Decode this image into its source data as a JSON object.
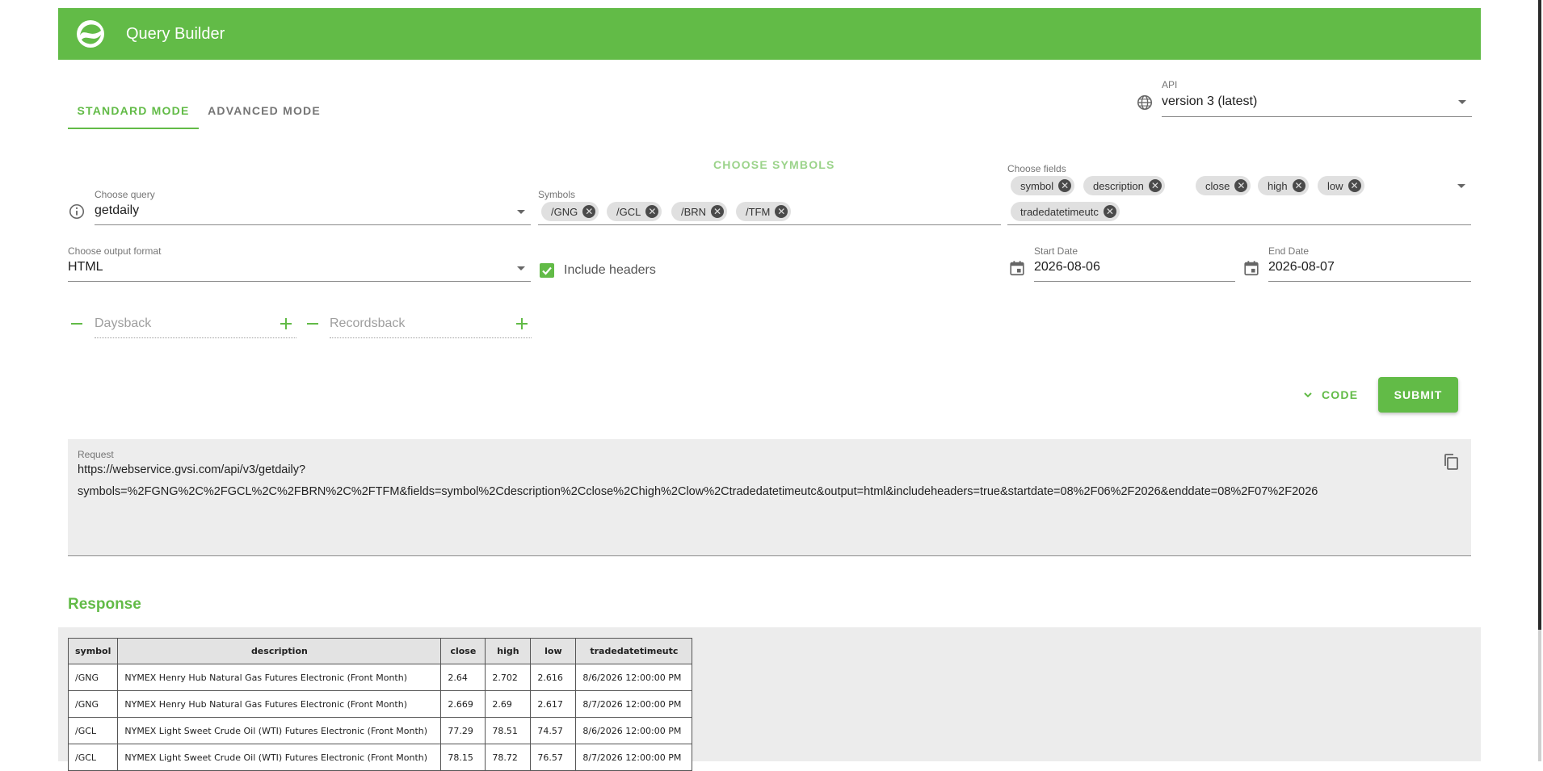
{
  "header": {
    "title": "Query Builder"
  },
  "tabs": [
    {
      "label": "STANDARD MODE"
    },
    {
      "label": "ADVANCED MODE"
    }
  ],
  "api": {
    "label": "API",
    "value": "version 3 (latest)"
  },
  "choose_symbols_label": "CHOOSE SYMBOLS",
  "query": {
    "label": "Choose query",
    "value": "getdaily"
  },
  "symbols": {
    "label": "Symbols",
    "chips": [
      "/GNG",
      "/GCL",
      "/BRN",
      "/TFM"
    ]
  },
  "fields": {
    "label": "Choose fields",
    "chips": [
      "symbol",
      "description",
      "close",
      "high",
      "low",
      "tradedatetimeutc"
    ]
  },
  "output": {
    "label": "Choose output format",
    "value": "HTML"
  },
  "include_headers": {
    "label": "Include headers",
    "checked": true
  },
  "start_date": {
    "label": "Start Date",
    "value": "2026-08-06"
  },
  "end_date": {
    "label": "End Date",
    "value": "2026-08-07"
  },
  "daysback": {
    "placeholder": "Daysback"
  },
  "recordsback": {
    "placeholder": "Recordsback"
  },
  "code_button": "CODE",
  "submit_button": "SUBMIT",
  "request": {
    "label": "Request",
    "line1": "https://webservice.gvsi.com/api/v3/getdaily?",
    "line2": "symbols=%2FGNG%2C%2FGCL%2C%2FBRN%2C%2FTFM&fields=symbol%2Cdescription%2Cclose%2Chigh%2Clow%2Ctradedatetimeutc&output=html&includeheaders=true&startdate=08%2F06%2F2026&enddate=08%2F07%2F2026"
  },
  "response": {
    "title": "Response",
    "columns": [
      "symbol",
      "description",
      "close",
      "high",
      "low",
      "tradedatetimeutc"
    ],
    "rows": [
      [
        "/GNG",
        "NYMEX Henry Hub Natural Gas Futures Electronic (Front Month)",
        "2.64",
        "2.702",
        "2.616",
        "8/6/2026 12:00:00 PM"
      ],
      [
        "/GNG",
        "NYMEX Henry Hub Natural Gas Futures Electronic (Front Month)",
        "2.669",
        "2.69",
        "2.617",
        "8/7/2026 12:00:00 PM"
      ],
      [
        "/GCL",
        "NYMEX Light Sweet Crude Oil (WTI) Futures Electronic (Front Month)",
        "77.29",
        "78.51",
        "74.57",
        "8/6/2026 12:00:00 PM"
      ],
      [
        "/GCL",
        "NYMEX Light Sweet Crude Oil (WTI) Futures Electronic (Front Month)",
        "78.15",
        "78.72",
        "76.57",
        "8/7/2026 12:00:00 PM"
      ]
    ]
  },
  "colors": {
    "accent": "#62bb47",
    "panel": "#ededed"
  }
}
